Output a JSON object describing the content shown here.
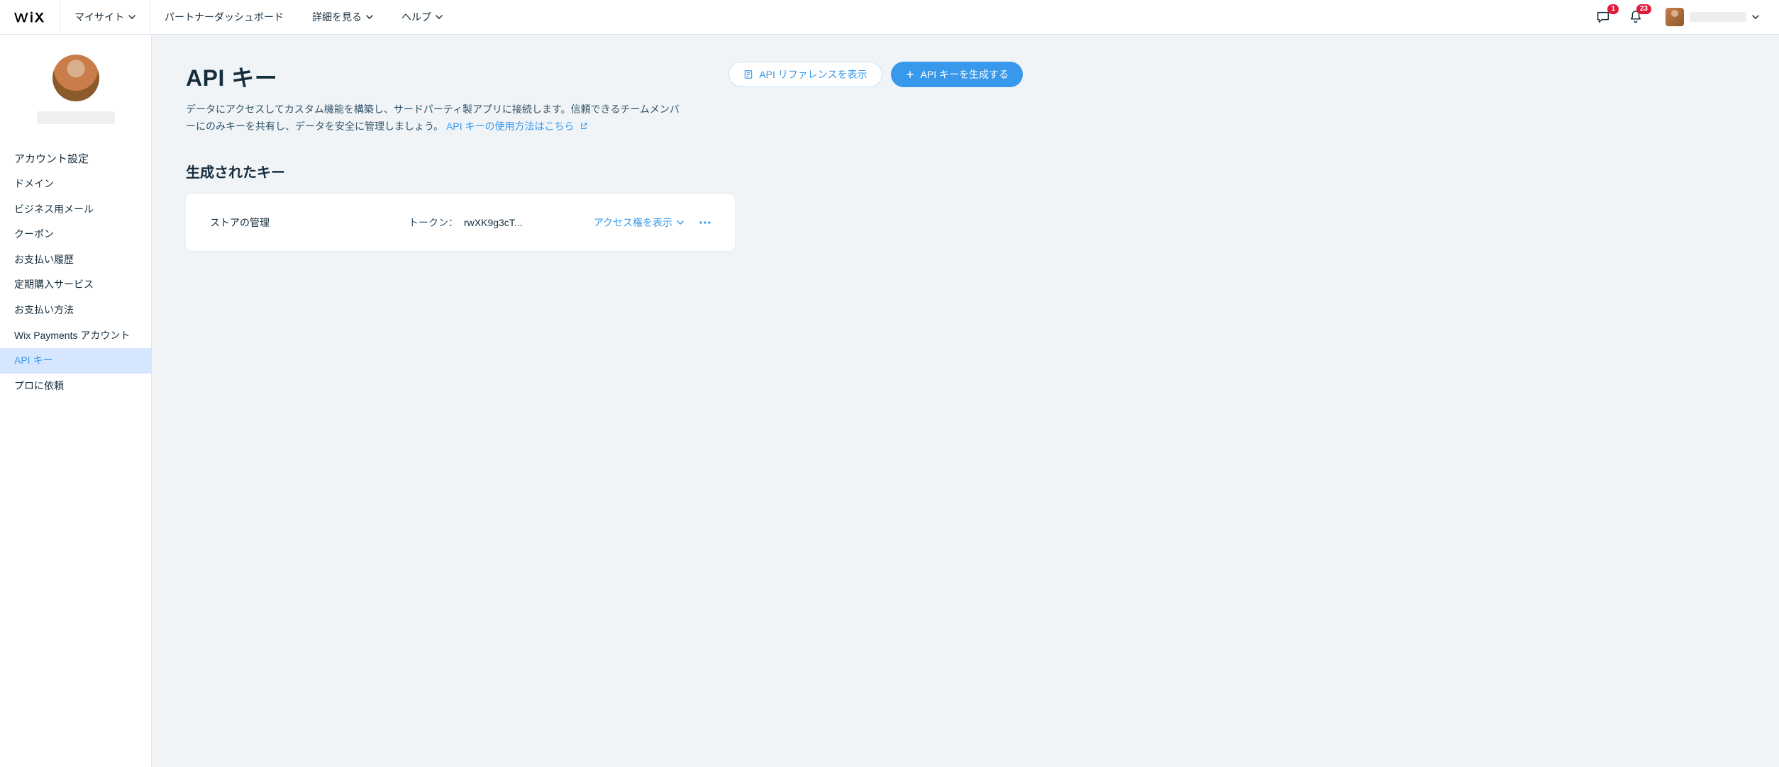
{
  "brand": "WiX",
  "topnav": {
    "mysites": "マイサイト",
    "partner": "パートナーダッシュボード",
    "details": "詳細を見る",
    "help": "ヘルプ"
  },
  "badges": {
    "inbox": "1",
    "notifications": "23"
  },
  "sidebar": {
    "section_title": "アカウント設定",
    "items": [
      "ドメイン",
      "ビジネス用メール",
      "クーポン",
      "お支払い履歴",
      "定期購入サービス",
      "お支払い方法",
      "Wix Payments アカウント",
      "API キー",
      "プロに依頼"
    ],
    "active_index": 7
  },
  "page": {
    "title": "API キー",
    "desc_prefix": "データにアクセスしてカスタム機能を構築し、サードパーティ製アプリに接続します。信頼できるチームメンバーにのみキーを共有し、データを安全に管理しましょう。",
    "desc_link": "API キーの使用方法はこちら"
  },
  "buttons": {
    "ref": "API リファレンスを表示",
    "generate": "API キーを生成する"
  },
  "section": {
    "generated_title": "生成されたキー"
  },
  "key": {
    "name": "ストアの管理",
    "token_label": "トークン：",
    "token_value": "rwXK9g3cT...",
    "permissions_label": "アクセス権を表示"
  }
}
